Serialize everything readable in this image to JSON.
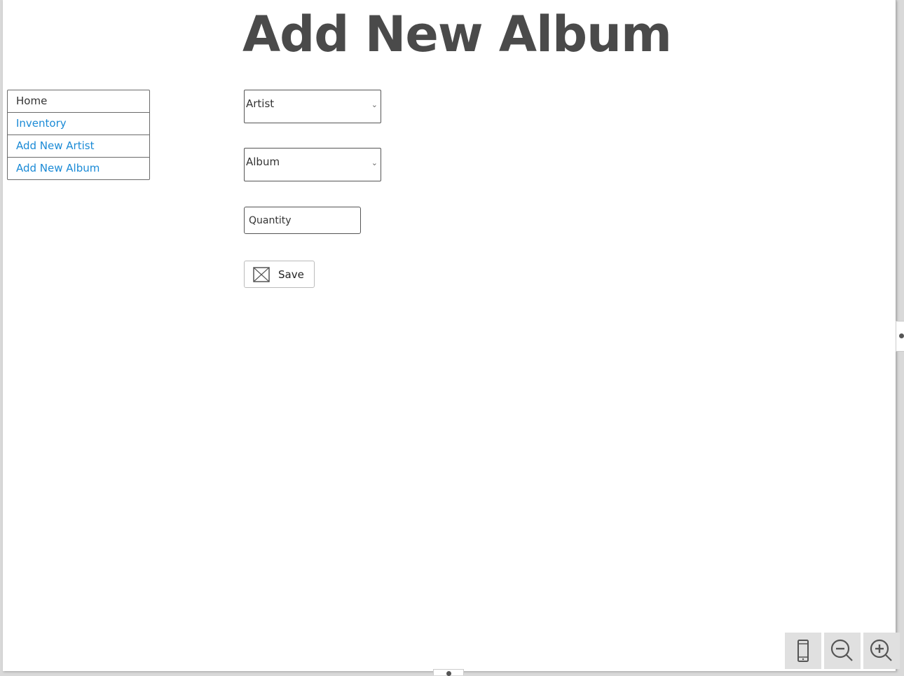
{
  "page": {
    "title": "Add New Album"
  },
  "nav": {
    "items": [
      {
        "label": "Home"
      },
      {
        "label": "Inventory"
      },
      {
        "label": "Add New Artist"
      },
      {
        "label": "Add New Album"
      }
    ]
  },
  "form": {
    "artist_select": {
      "selected": "Artist",
      "icon": "chevron-down-icon"
    },
    "album_select": {
      "selected": "Album",
      "icon": "chevron-down-icon"
    },
    "quantity_field": {
      "placeholder": "Quantity",
      "value": ""
    },
    "save_button": {
      "label": "Save",
      "icon": "image-placeholder-icon"
    }
  },
  "viewer_toolbar": {
    "buttons": [
      {
        "icon": "device-icon"
      },
      {
        "icon": "zoom-out-icon"
      },
      {
        "icon": "zoom-in-icon"
      }
    ]
  },
  "colors": {
    "link": "#1a8ad6",
    "title": "#4a4a4a",
    "canvas": "#ffffff",
    "toolbar_button": "#e0e0e0"
  }
}
